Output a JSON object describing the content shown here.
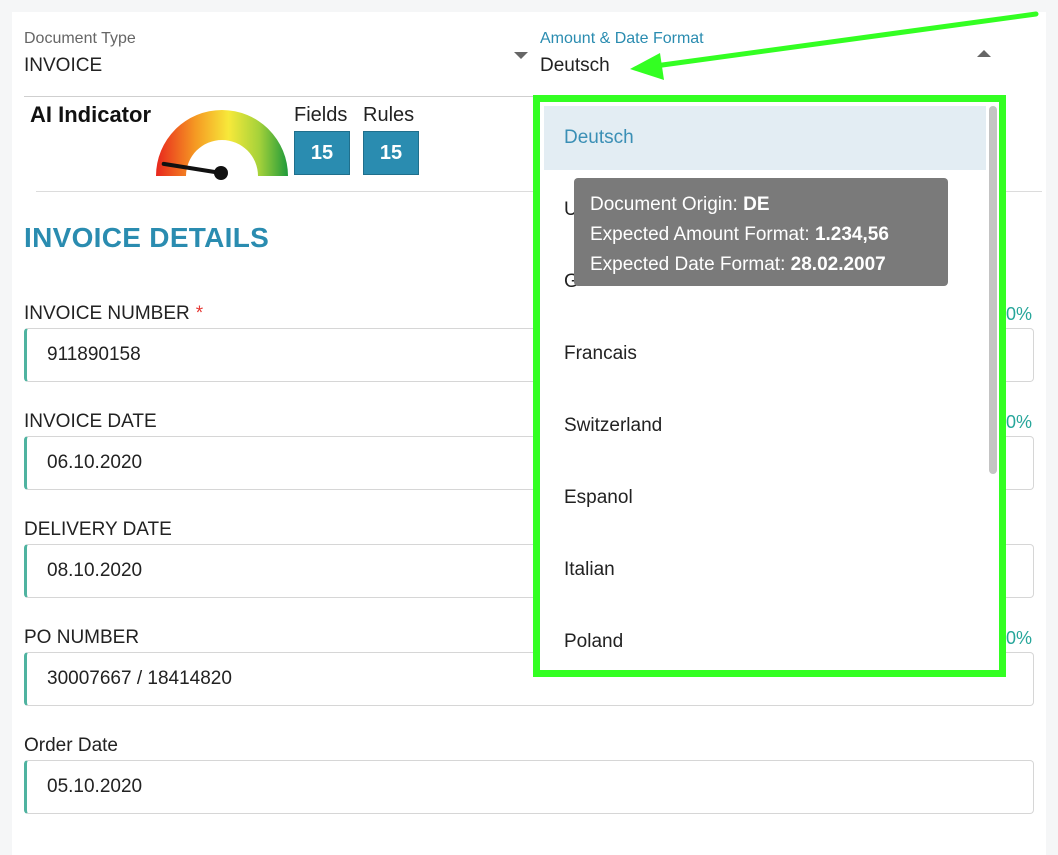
{
  "header": {
    "document_type": {
      "label": "Document Type",
      "value": "INVOICE"
    },
    "amount_date_format": {
      "label": "Amount & Date Format",
      "value": "Deutsch"
    }
  },
  "ai_indicator": {
    "title": "AI Indicator",
    "gauge_level": 0.05,
    "fields": {
      "label": "Fields",
      "value": "15"
    },
    "rules": {
      "label": "Rules",
      "value": "15"
    }
  },
  "section_title": "INVOICE DETAILS",
  "fields": [
    {
      "label": "INVOICE NUMBER",
      "required": "*",
      "value": "911890158",
      "pct": "0%"
    },
    {
      "label": "INVOICE DATE",
      "value": "06.10.2020",
      "pct": "0%"
    },
    {
      "label": "DELIVERY DATE",
      "value": "08.10.2020"
    },
    {
      "label": "PO NUMBER",
      "value": "30007667 / 18414820",
      "pct": "0%"
    },
    {
      "label": "Order Date",
      "value": "05.10.2020"
    }
  ],
  "dropdown": {
    "options": [
      "Deutsch",
      "U",
      "G",
      "Francais",
      "Switzerland",
      "Espanol",
      "Italian",
      "Poland"
    ],
    "selected": "Deutsch"
  },
  "tooltip": {
    "origin_label": "Document Origin:",
    "origin_value": "DE",
    "amount_label": "Expected Amount Format:",
    "amount_value": "1.234,56",
    "date_label": "Expected Date Format:",
    "date_value": "28.02.2007"
  },
  "colors": {
    "accent": "#2a8cb0",
    "highlight_border": "#33ff22",
    "field_accent": "#4fb3a0",
    "percent": "#26a69a"
  }
}
